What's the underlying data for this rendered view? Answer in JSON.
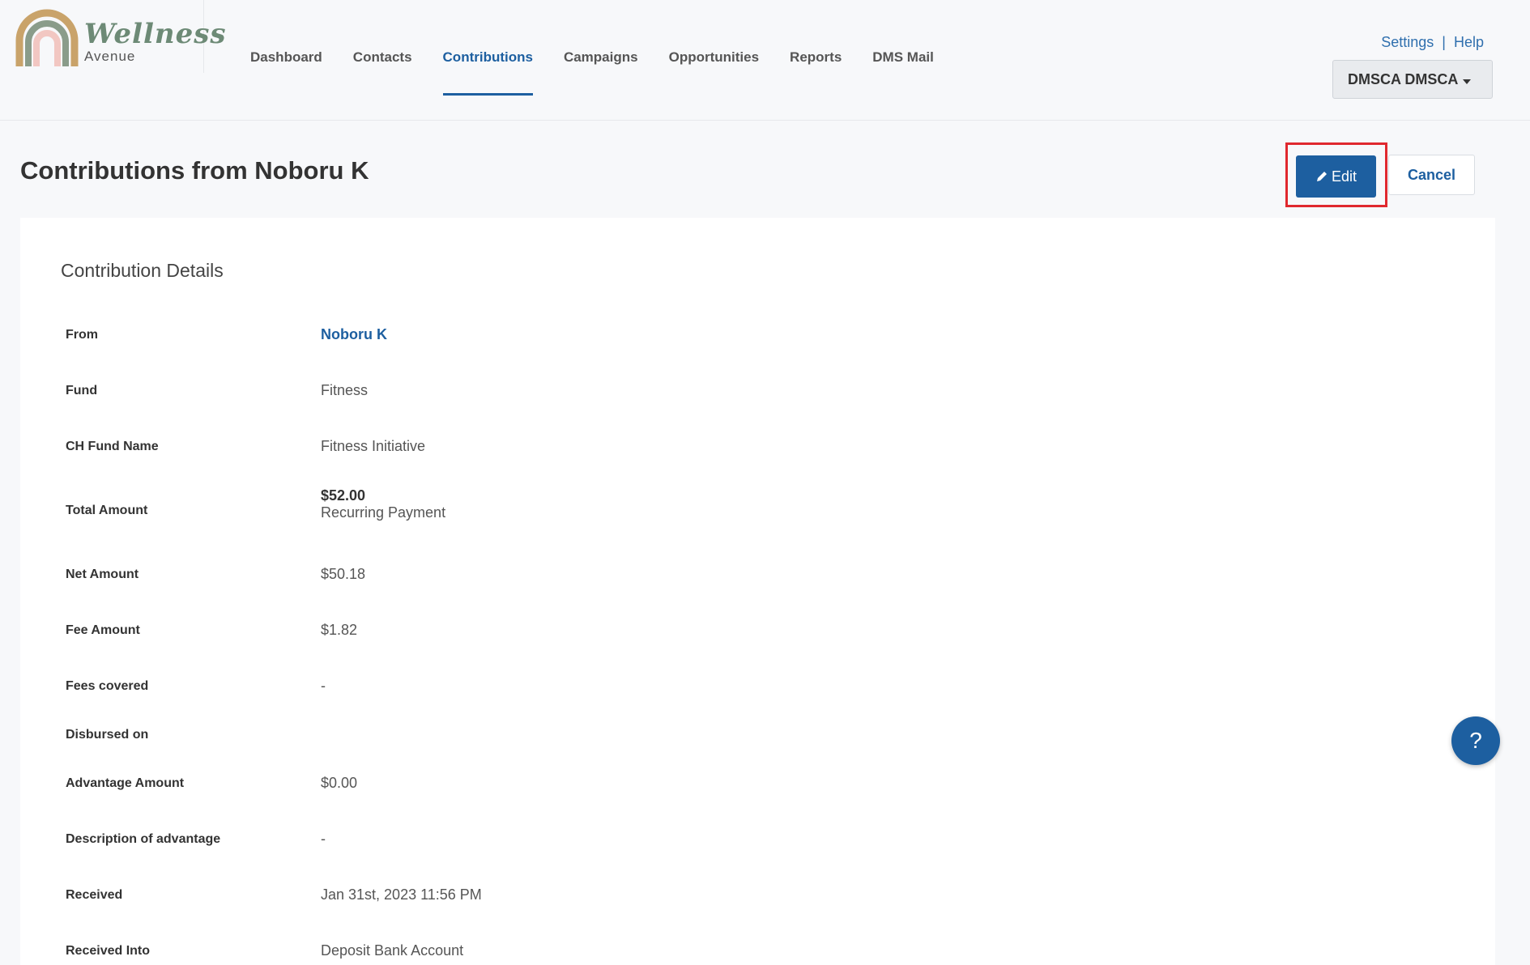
{
  "brand": {
    "name": "Wellness",
    "sub": "Avenue"
  },
  "nav": [
    {
      "label": "Dashboard",
      "active": false
    },
    {
      "label": "Contacts",
      "active": false
    },
    {
      "label": "Contributions",
      "active": true
    },
    {
      "label": "Campaigns",
      "active": false
    },
    {
      "label": "Opportunities",
      "active": false
    },
    {
      "label": "Reports",
      "active": false
    },
    {
      "label": "DMS Mail",
      "active": false
    }
  ],
  "top_links": {
    "settings": "Settings",
    "separator": "|",
    "help": "Help"
  },
  "user_menu": {
    "label": "DMSCA DMSCA"
  },
  "page": {
    "title": "Contributions from Noboru K",
    "edit_label": "Edit",
    "cancel_label": "Cancel"
  },
  "details": {
    "title": "Contribution Details",
    "from_label": "From",
    "from_value": "Noboru K",
    "fund_label": "Fund",
    "fund_value": "Fitness",
    "ch_fund_label": "CH Fund Name",
    "ch_fund_value": "Fitness Initiative",
    "total_label": "Total Amount",
    "total_value": "$52.00",
    "total_note": "Recurring Payment",
    "net_label": "Net Amount",
    "net_value": "$50.18",
    "fee_label": "Fee Amount",
    "fee_value": "$1.82",
    "fees_covered_label": "Fees covered",
    "fees_covered_value": "-",
    "disbursed_label": "Disbursed on",
    "disbursed_value": "",
    "advantage_label": "Advantage Amount",
    "advantage_value": "$0.00",
    "advantage_desc_label": "Description of advantage",
    "advantage_desc_value": "-",
    "received_label": "Received",
    "received_value": "Jan 31st, 2023 11:56 PM",
    "received_into_label": "Received Into",
    "received_into_value": "Deposit Bank Account"
  },
  "help_fab": {
    "label": "?"
  },
  "colors": {
    "primary": "#1d5fa0",
    "highlight": "#e0282e"
  }
}
